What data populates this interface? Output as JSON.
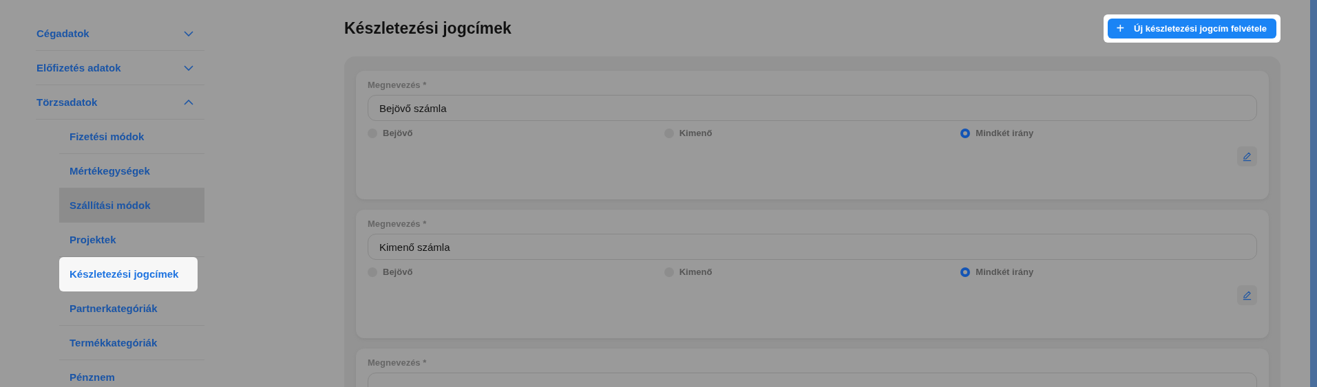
{
  "sidebar": {
    "items": [
      {
        "label": "Cégadatok",
        "expanded": false
      },
      {
        "label": "Előfizetés adatok",
        "expanded": false
      },
      {
        "label": "Törzsadatok",
        "expanded": true,
        "children": [
          {
            "label": "Fizetési módok",
            "selected": false,
            "hovered": false
          },
          {
            "label": "Mértékegységek",
            "selected": false,
            "hovered": false
          },
          {
            "label": "Szállítási módok",
            "selected": false,
            "hovered": true
          },
          {
            "label": "Projektek",
            "selected": false,
            "hovered": false
          },
          {
            "label": "Készletezési jogcímek",
            "selected": true,
            "hovered": false
          },
          {
            "label": "Partnerkategóriák",
            "selected": false,
            "hovered": false
          },
          {
            "label": "Termékkategóriák",
            "selected": false,
            "hovered": false
          },
          {
            "label": "Pénznem",
            "selected": false,
            "hovered": false
          }
        ]
      }
    ]
  },
  "page": {
    "title": "Készletezési jogcímek",
    "add_button": {
      "icon": "+",
      "label": "Új készletezési jogcím felvétele"
    }
  },
  "cards": [
    {
      "name_label": "Megnevezés *",
      "name_value": "Bejövő számla",
      "options": [
        {
          "label": "Bejövő",
          "selected": false
        },
        {
          "label": "Kimenő",
          "selected": false
        },
        {
          "label": "Mindkét irány",
          "selected": true
        }
      ]
    },
    {
      "name_label": "Megnevezés *",
      "name_value": "Kimenő számla",
      "options": [
        {
          "label": "Bejövő",
          "selected": false
        },
        {
          "label": "Kimenő",
          "selected": false
        },
        {
          "label": "Mindkét irány",
          "selected": true
        }
      ]
    },
    {
      "name_label": "Megnevezés *"
    }
  ]
}
